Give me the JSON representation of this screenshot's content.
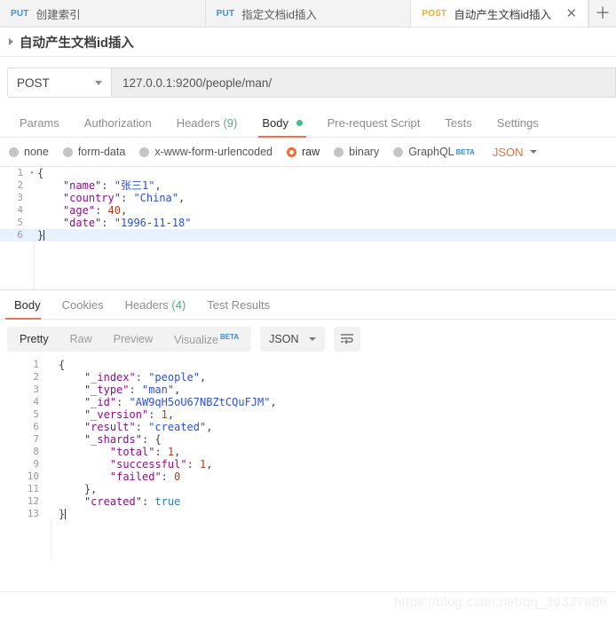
{
  "tabs": [
    {
      "method": "PUT",
      "name": "创建索引",
      "active": false
    },
    {
      "method": "PUT",
      "name": "指定文档id插入",
      "active": false
    },
    {
      "method": "POST",
      "name": "自动产生文档id插入",
      "active": true
    }
  ],
  "tab_close_icon": "✕",
  "tab_add_icon": "＋",
  "breadcrumb": {
    "title": "自动产生文档id插入"
  },
  "url_bar": {
    "method": "POST",
    "url": "127.0.0.1:9200/people/man/"
  },
  "request_tabs": [
    {
      "label": "Params",
      "count": "",
      "active": false
    },
    {
      "label": "Authorization",
      "count": "",
      "active": false
    },
    {
      "label": "Headers",
      "count": "(9)",
      "active": false
    },
    {
      "label": "Body",
      "count": "",
      "active": true
    },
    {
      "label": "Pre-request Script",
      "count": "",
      "active": false
    },
    {
      "label": "Tests",
      "count": "",
      "active": false
    },
    {
      "label": "Settings",
      "count": "",
      "active": false
    }
  ],
  "body_types": [
    {
      "label": "none",
      "selected": false
    },
    {
      "label": "form-data",
      "selected": false
    },
    {
      "label": "x-www-form-urlencoded",
      "selected": false
    },
    {
      "label": "raw",
      "selected": true
    },
    {
      "label": "binary",
      "selected": false
    },
    {
      "label": "GraphQL",
      "selected": false,
      "beta": "BETA"
    }
  ],
  "body_format": {
    "value": "JSON"
  },
  "request_body": {
    "lines": [
      {
        "num": "1",
        "fold": "▾",
        "text": "{",
        "highlight": false
      },
      {
        "num": "2",
        "fold": "",
        "text": "    \"name\": \"张三1\",",
        "highlight": false
      },
      {
        "num": "3",
        "fold": "",
        "text": "    \"country\": \"China\",",
        "highlight": false
      },
      {
        "num": "4",
        "fold": "",
        "text": "    \"age\": 40,",
        "highlight": false
      },
      {
        "num": "5",
        "fold": "",
        "text": "    \"date\": \"1996-11-18\"",
        "highlight": false
      },
      {
        "num": "6",
        "fold": "",
        "text": "}",
        "highlight": true
      }
    ],
    "raw": "{\n    \"name\": \"张三1\",\n    \"country\": \"China\",\n    \"age\": 40,\n    \"date\": \"1996-11-18\"\n}"
  },
  "response_tabs": [
    {
      "label": "Body",
      "count": "",
      "active": true
    },
    {
      "label": "Cookies",
      "count": "",
      "active": false
    },
    {
      "label": "Headers",
      "count": "(4)",
      "active": false
    },
    {
      "label": "Test Results",
      "count": "",
      "active": false
    }
  ],
  "response_view": {
    "segments": [
      {
        "label": "Pretty",
        "active": true
      },
      {
        "label": "Raw",
        "active": false
      },
      {
        "label": "Preview",
        "active": false
      },
      {
        "label": "Visualize",
        "active": false,
        "beta": "BETA"
      }
    ],
    "format": "JSON",
    "wrap_icon": "wrap-lines-icon"
  },
  "response_body": {
    "lines": [
      {
        "num": "1",
        "text": "{"
      },
      {
        "num": "2",
        "text": "    \"_index\": \"people\","
      },
      {
        "num": "3",
        "text": "    \"_type\": \"man\","
      },
      {
        "num": "4",
        "text": "    \"_id\": \"AW9qH5oU67NBZtCQuFJM\","
      },
      {
        "num": "5",
        "text": "    \"_version\": 1,"
      },
      {
        "num": "6",
        "text": "    \"result\": \"created\","
      },
      {
        "num": "7",
        "text": "    \"_shards\": {"
      },
      {
        "num": "8",
        "text": "        \"total\": 1,"
      },
      {
        "num": "9",
        "text": "        \"successful\": 1,"
      },
      {
        "num": "10",
        "text": "        \"failed\": 0"
      },
      {
        "num": "11",
        "text": "    },"
      },
      {
        "num": "12",
        "text": "    \"created\": true"
      },
      {
        "num": "13",
        "text": "}"
      }
    ],
    "values": {
      "_index": "people",
      "_type": "man",
      "_id": "AW9qH5oU67NBZtCQuFJM",
      "_version": 1,
      "result": "created",
      "_shards": {
        "total": 1,
        "successful": 1,
        "failed": 0
      },
      "created": true
    }
  },
  "watermark": "https://blog.csdn.net/qq_39337886",
  "colors": {
    "accent_orange": "#ef6c35",
    "tab_underline": "#f0714e",
    "put_blue": "#3e8ee0",
    "post_yellow": "#f0ad2e",
    "green_dot": "#3ec08a",
    "count_green": "#4caf84",
    "beta_blue": "#3b8ae0"
  }
}
